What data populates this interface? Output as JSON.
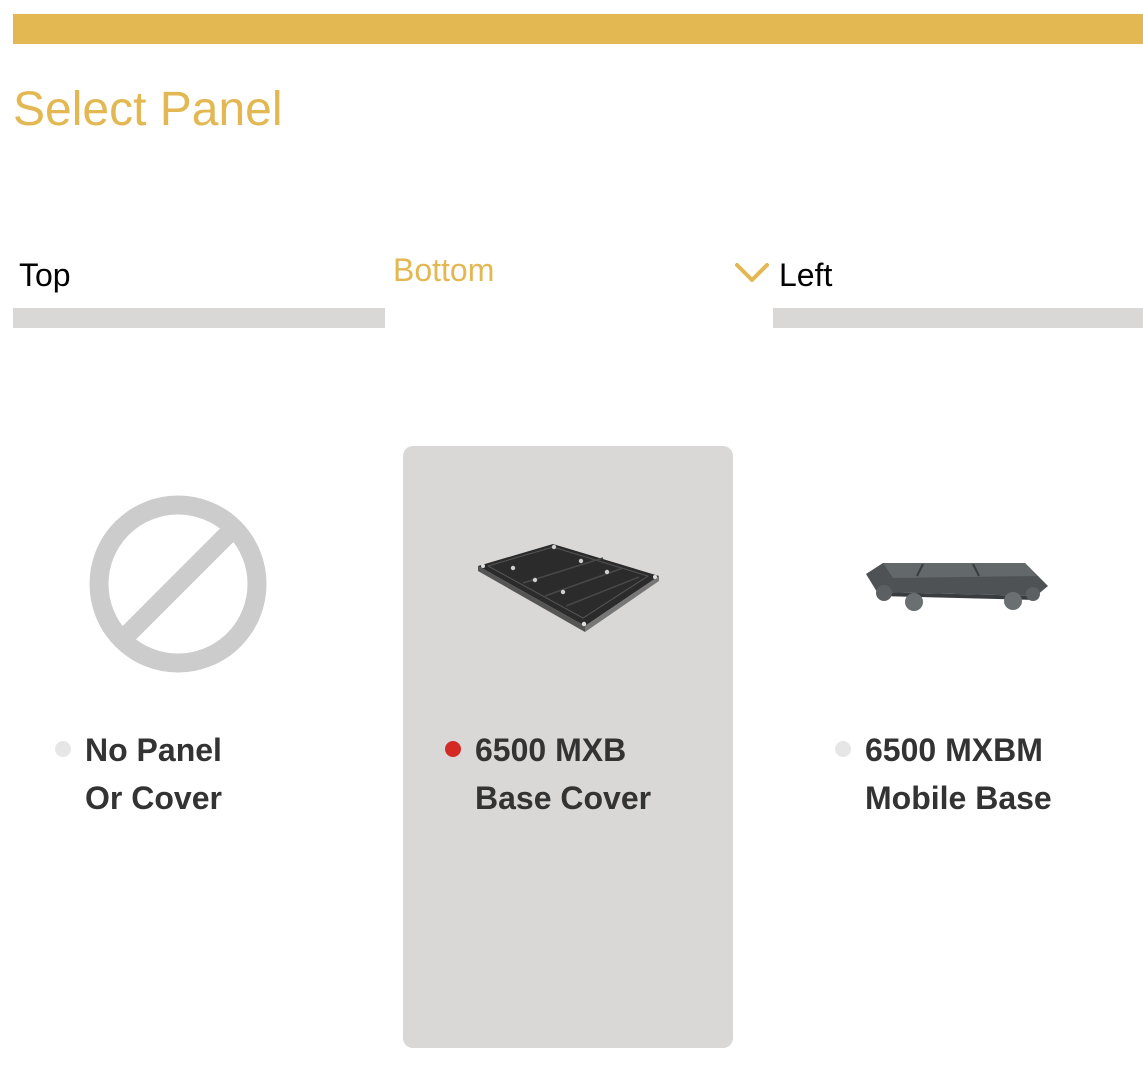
{
  "header": {
    "title": "Select Panel",
    "accent_color": "#e3b751"
  },
  "tabs": [
    {
      "label": "Top",
      "active": false
    },
    {
      "label": "Bottom",
      "active": true
    },
    {
      "label": "Left",
      "active": false
    }
  ],
  "options": [
    {
      "line1": "No Panel",
      "line2": "Or Cover",
      "selected": false,
      "icon": "no-panel-icon"
    },
    {
      "line1": "6500 MXB",
      "line2": "Base Cover",
      "selected": true,
      "icon": "base-cover-image"
    },
    {
      "line1": "6500 MXBM",
      "line2": "Mobile Base",
      "selected": false,
      "icon": "mobile-base-image"
    }
  ],
  "colors": {
    "selected_radio": "#d42a26",
    "card_selected_bg": "#d9d8d7",
    "tab_underline": "#d9d8d7"
  }
}
